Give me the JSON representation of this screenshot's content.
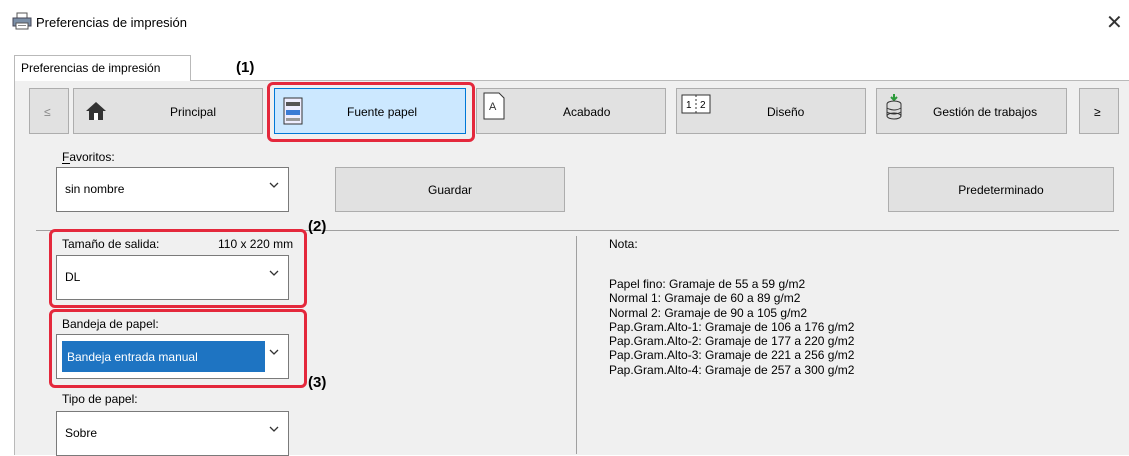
{
  "window": {
    "title": "Preferencias de impresión"
  },
  "tab": {
    "label": "Preferencias de impresión"
  },
  "nav": {
    "prev": "≤",
    "next": "≥",
    "buttons": [
      "Principal",
      "Fuente papel",
      "Acabado",
      "Diseño",
      "Gestión de trabajos"
    ]
  },
  "favorites": {
    "label": "Favoritos:",
    "value": "sin nombre",
    "save": "Guardar",
    "default": "Predeterminado"
  },
  "output_size": {
    "label": "Tamaño de salida:",
    "dimensions": "110 x 220 mm",
    "value": "DL"
  },
  "tray": {
    "label": "Bandeja de papel:",
    "value": "Bandeja entrada manual"
  },
  "paper_type": {
    "label": "Tipo de papel:",
    "value": "Sobre"
  },
  "note": {
    "title": "Nota:",
    "lines": [
      "Papel fino: Gramaje de 55 a 59 g/m2",
      "Normal 1: Gramaje de 60 a 89 g/m2",
      "Normal 2: Gramaje de 90 a 105 g/m2",
      "Pap.Gram.Alto-1: Gramaje de 106 a 176 g/m2",
      "Pap.Gram.Alto-2: Gramaje de 177 a 220 g/m2",
      "Pap.Gram.Alto-3: Gramaje de 221 a 256 g/m2",
      "Pap.Gram.Alto-4: Gramaje de 257 a 300 g/m2"
    ]
  },
  "callouts": [
    "(1)",
    "(2)",
    "(3)"
  ],
  "colors": {
    "highlight_red": "#e4283c",
    "selected_blue": "#1e74c2",
    "active_tab_blue": "#cce8ff"
  }
}
